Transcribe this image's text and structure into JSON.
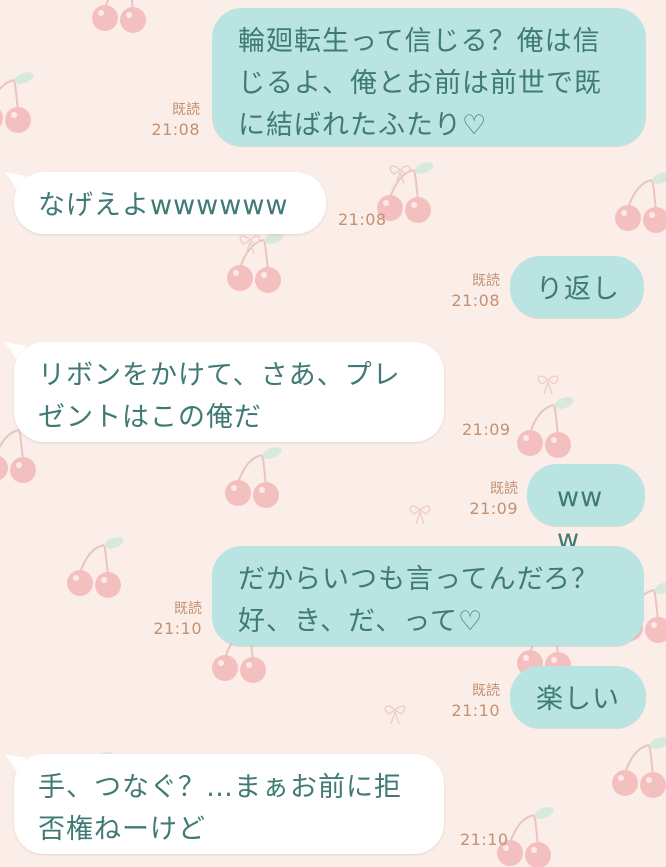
{
  "colors": {
    "background": "#fbeee8",
    "outgoing_bubble": "#b9e4e1",
    "incoming_bubble": "#ffffff",
    "message_text": "#3f7a74",
    "meta_text": "#c29172",
    "cherry": "#f3b9b9",
    "leaf": "#cfe3d4"
  },
  "messages": [
    {
      "direction": "out",
      "text": "輪廻転生って信じる？俺は信じるよ、俺とお前は前世で既に結ばれたふたり♡",
      "read_label": "既読",
      "time": "21:08"
    },
    {
      "direction": "in",
      "text": "なげえよwwwwww",
      "time": "21:08"
    },
    {
      "direction": "out",
      "text": "り返し",
      "read_label": "既読",
      "time": "21:08"
    },
    {
      "direction": "in",
      "text": "リボンをかけて、さあ、プレゼントはこの俺だ",
      "time": "21:09"
    },
    {
      "direction": "out",
      "text": "www",
      "read_label": "既読",
      "time": "21:09"
    },
    {
      "direction": "out",
      "text": "だからいつも言ってんだろ？好、き、だ、って♡",
      "read_label": "既読",
      "time": "21:10"
    },
    {
      "direction": "out",
      "text": "楽しい",
      "read_label": "既読",
      "time": "21:10"
    },
    {
      "direction": "in",
      "text": "手、つなぐ？…まぁお前に拒否権ねーけど",
      "time": "21:10"
    }
  ]
}
